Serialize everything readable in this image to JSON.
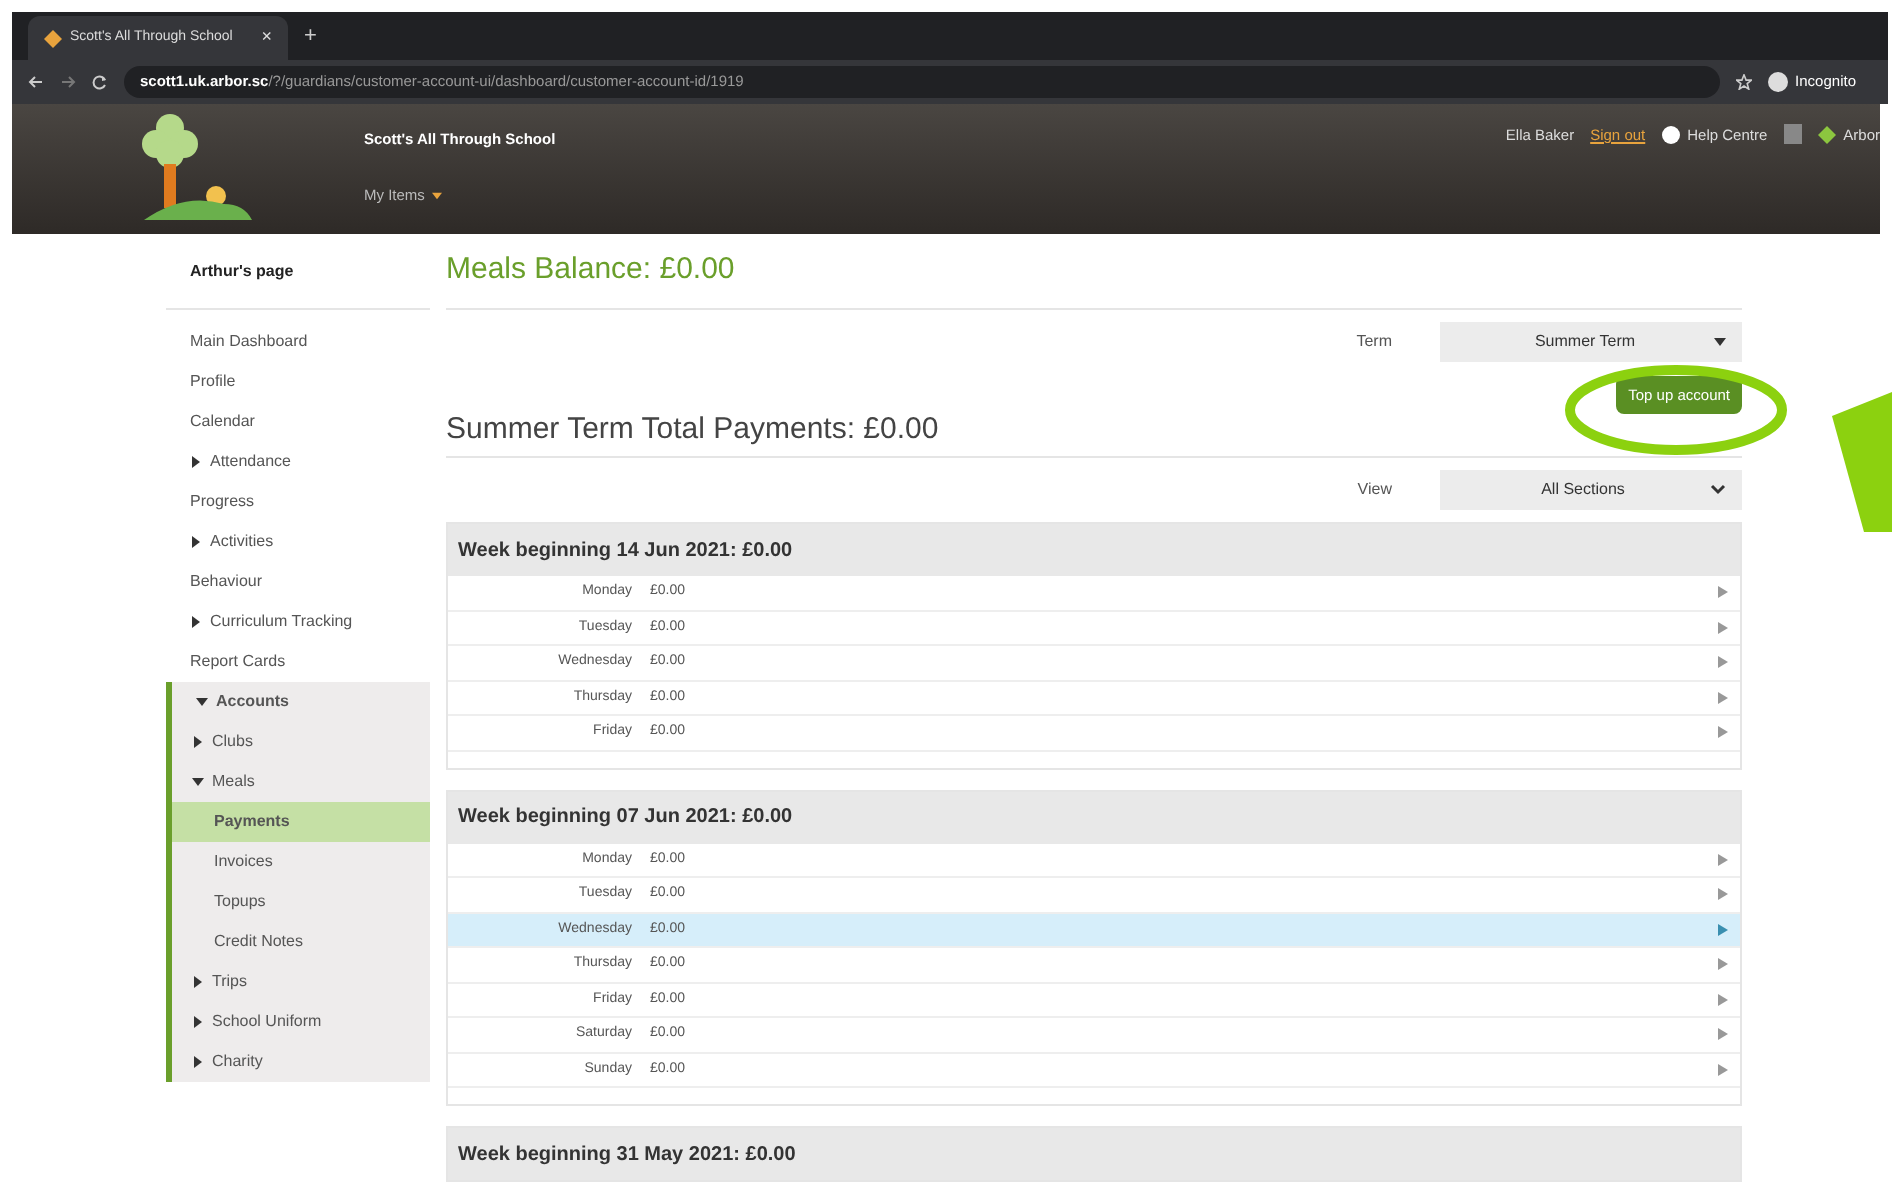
{
  "browser": {
    "tab_title": "Scott's All Through School",
    "tab_close": "×",
    "new_tab": "+",
    "url_host": "scott1.uk.arbor.sc",
    "url_path": "/?/guardians/customer-account-ui/dashboard/customer-account-id/1919",
    "incognito": "Incognito"
  },
  "header": {
    "school_name": "Scott's All Through School",
    "menu": "My Items",
    "user": "Ella Baker",
    "sign_out": "Sign out",
    "help": "Help Centre",
    "brand": "Arbor"
  },
  "sidebar": {
    "title": "Arthur's page",
    "items": [
      {
        "label": "Main Dashboard",
        "selected": false
      },
      {
        "label": "Profile",
        "selected": false
      },
      {
        "label": "Calendar",
        "selected": false
      },
      {
        "label": "Attendance",
        "selected": false,
        "expanded": false
      },
      {
        "label": "Progress",
        "selected": false
      },
      {
        "label": "Activities",
        "selected": false,
        "expanded": false
      },
      {
        "label": "Behaviour",
        "selected": false
      },
      {
        "label": "Curriculum Tracking",
        "selected": false,
        "expanded": false
      },
      {
        "label": "Report Cards",
        "selected": false
      },
      {
        "label": "Accounts",
        "selected": false,
        "expanded": true,
        "children": [
          {
            "label": "Clubs",
            "selected": false,
            "expanded": false
          },
          {
            "label": "Meals",
            "selected": false,
            "expanded": true,
            "children": [
              {
                "label": "Payments",
                "selected": true
              },
              {
                "label": "Invoices",
                "selected": false
              },
              {
                "label": "Topups",
                "selected": false
              },
              {
                "label": "Credit Notes",
                "selected": false
              }
            ]
          },
          {
            "label": "Trips",
            "selected": false,
            "expanded": false
          },
          {
            "label": "School Uniform",
            "selected": false,
            "expanded": false
          },
          {
            "label": "Charity",
            "selected": false,
            "expanded": false
          }
        ]
      }
    ]
  },
  "main": {
    "balance_title": "Meals Balance: £0.00",
    "term_label": "Term",
    "term_value": "Summer Term",
    "top_up_button": "Top up account",
    "total_title": "Summer Term Total Payments: £0.00",
    "view_label": "View",
    "view_value": "All Sections",
    "weeks": [
      {
        "title": "Week beginning 14 Jun 2021: £0.00",
        "rows": [
          {
            "day": "Monday",
            "amount": "£0.00",
            "highlighted": false
          },
          {
            "day": "Tuesday",
            "amount": "£0.00",
            "highlighted": false
          },
          {
            "day": "Wednesday",
            "amount": "£0.00",
            "highlighted": false
          },
          {
            "day": "Thursday",
            "amount": "£0.00",
            "highlighted": false
          },
          {
            "day": "Friday",
            "amount": "£0.00",
            "highlighted": false
          }
        ]
      },
      {
        "title": "Week beginning 07 Jun 2021: £0.00",
        "rows": [
          {
            "day": "Monday",
            "amount": "£0.00",
            "highlighted": false
          },
          {
            "day": "Tuesday",
            "amount": "£0.00",
            "highlighted": false
          },
          {
            "day": "Wednesday",
            "amount": "£0.00",
            "highlighted": true
          },
          {
            "day": "Thursday",
            "amount": "£0.00",
            "highlighted": false
          },
          {
            "day": "Friday",
            "amount": "£0.00",
            "highlighted": false
          },
          {
            "day": "Saturday",
            "amount": "£0.00",
            "highlighted": false
          },
          {
            "day": "Sunday",
            "amount": "£0.00",
            "highlighted": false
          }
        ]
      },
      {
        "title": "Week beginning 31 May 2021: £0.00"
      }
    ]
  }
}
